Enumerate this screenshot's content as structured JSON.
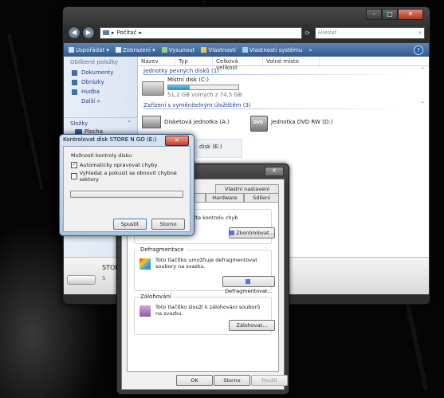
{
  "explorer": {
    "breadcrumb": "Počítač",
    "search_placeholder": "Hledat",
    "toolbar": [
      "Uspořádat ▾",
      "Zobrazení ▾",
      "Vysunout",
      "Vlastnosti",
      "Vlastnosti systému",
      "»"
    ],
    "nav": {
      "favorites_header": "Oblíbené položky",
      "favorites": [
        "Dokumenty",
        "Obrázky",
        "Hudba"
      ],
      "more": "Další »",
      "folders_header": "Složky",
      "folder_item": "Plocha"
    },
    "columns": [
      "Název",
      "Typ",
      "Celková velikost",
      "Volné místo"
    ],
    "group_hdd": "Jednotky pevných disků (1)",
    "local_disk": {
      "name": "Místní disk (C:)",
      "free_text": "51,2 GB volných z 74,5 GB",
      "used_fraction": 0.31
    },
    "group_removable": "Zařízení s vyměnitelným úložištěm (3)",
    "floppy": "Disketová jednotka (A:)",
    "dvd": "Jednotka DVD RW (D:)",
    "removable_e": "disk (E:)",
    "details_name": "STOR",
    "details_sub": "S"
  },
  "props": {
    "title_tail": "sti",
    "tabs_row1": [
      "Vlastní nastavení"
    ],
    "tabs_row2": [
      "Hardware",
      "Sdílení"
    ],
    "check_text": "ťte kontrolu chyb",
    "check_button": "Zkontrolovat...",
    "defrag_title": "Defragmentace",
    "defrag_text": "Toto tlačítko umožňuje defragmentovat soubory na svazku.",
    "defrag_button": "Defragmentovat...",
    "backup_title": "Zálohování",
    "backup_text": "Toto tlačítko slouží k zálohování souborů na svazku.",
    "backup_button": "Zálohovat...",
    "ok": "OK",
    "cancel": "Storno",
    "apply": "Použít"
  },
  "chk": {
    "title": "Kontrolovat disk STORE N GO (E:)",
    "options_label": "Možnosti kontroly disku",
    "opt1": "Automaticky opravovat chyby",
    "opt1_checked": true,
    "opt2": "Vyhledat a pokusit se obnovit chybné sektory",
    "opt2_checked": false,
    "start": "Spustit",
    "cancel": "Storno"
  }
}
